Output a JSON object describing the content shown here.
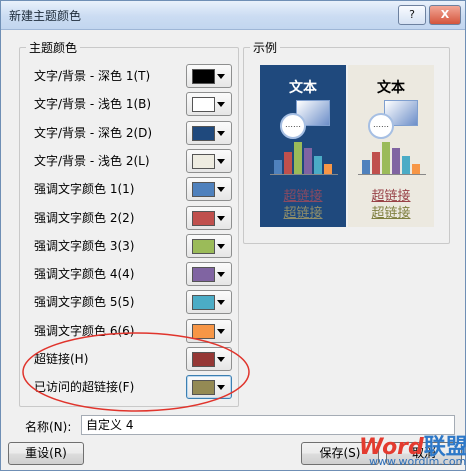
{
  "window": {
    "title": "新建主题颜色",
    "help_label": "?",
    "close_label": "X"
  },
  "theme_colors": {
    "group_title": "主题颜色",
    "rows": [
      {
        "label": "文字/背景 - 深色 1(T)",
        "color": "#000000"
      },
      {
        "label": "文字/背景 - 浅色 1(B)",
        "color": "#ffffff"
      },
      {
        "label": "文字/背景 - 深色 2(D)",
        "color": "#1f497d"
      },
      {
        "label": "文字/背景 - 浅色 2(L)",
        "color": "#eeece1"
      },
      {
        "label": "强调文字颜色 1(1)",
        "color": "#4f81bd"
      },
      {
        "label": "强调文字颜色 2(2)",
        "color": "#c0504d"
      },
      {
        "label": "强调文字颜色 3(3)",
        "color": "#9bbb59"
      },
      {
        "label": "强调文字颜色 4(4)",
        "color": "#8064a2"
      },
      {
        "label": "强调文字颜色 5(5)",
        "color": "#4bacc6"
      },
      {
        "label": "强调文字颜色 6(6)",
        "color": "#f79646"
      },
      {
        "label": "超链接(H)",
        "color": "#953735"
      },
      {
        "label": "已访问的超链接(F)",
        "color": "#948a54"
      }
    ]
  },
  "preview": {
    "group_title": "示例",
    "dark_panel": {
      "title": "文本",
      "shape_text": "……",
      "hyperlink": "超链接",
      "visited_hyperlink": "超链接"
    },
    "light_panel": {
      "title": "文本",
      "shape_text": "……",
      "hyperlink": "超链接",
      "visited_hyperlink": "超链接"
    },
    "bar_colors": [
      "#4f81bd",
      "#c0504d",
      "#9bbb59",
      "#8064a2",
      "#4bacc6",
      "#f79646"
    ]
  },
  "name_field": {
    "label": "名称(N):",
    "value": "自定义 4"
  },
  "buttons": {
    "reset": "重设(R)",
    "save": "保存(S)",
    "cancel": "取消"
  },
  "watermark": {
    "brand_text": "Word",
    "brand_cn": "联盟",
    "url": "www.wordlm.com"
  },
  "annotation": {
    "color": "#e0342c"
  }
}
